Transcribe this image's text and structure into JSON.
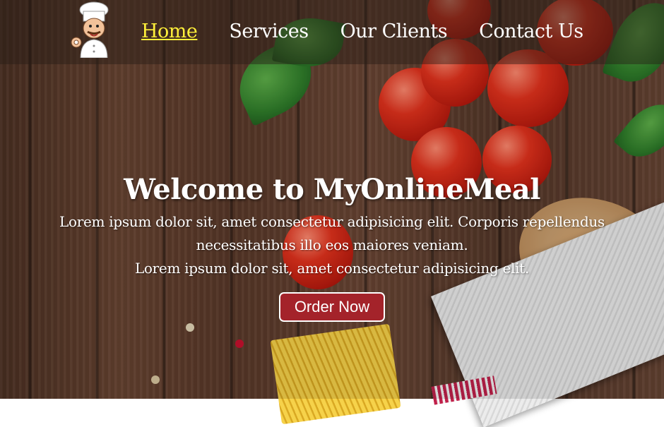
{
  "nav": {
    "logo_icon": "chef-logo-icon",
    "items": [
      {
        "label": "Home",
        "active": true
      },
      {
        "label": "Services",
        "active": false
      },
      {
        "label": "Our Clients",
        "active": false
      },
      {
        "label": "Contact Us",
        "active": false
      }
    ],
    "active_color": "#ffef3a"
  },
  "hero": {
    "title": "Welcome to MyOnlineMeal",
    "paragraph_line1": "Lorem ipsum dolor sit, amet consectetur adipisicing elit. Corporis repellendus necessitatibus illo eos maiores veniam.",
    "paragraph_line2": "Lorem ipsum dolor sit, amet consectetur adipisicing elit.",
    "cta_label": "Order Now",
    "cta_color": "#a4232a"
  }
}
